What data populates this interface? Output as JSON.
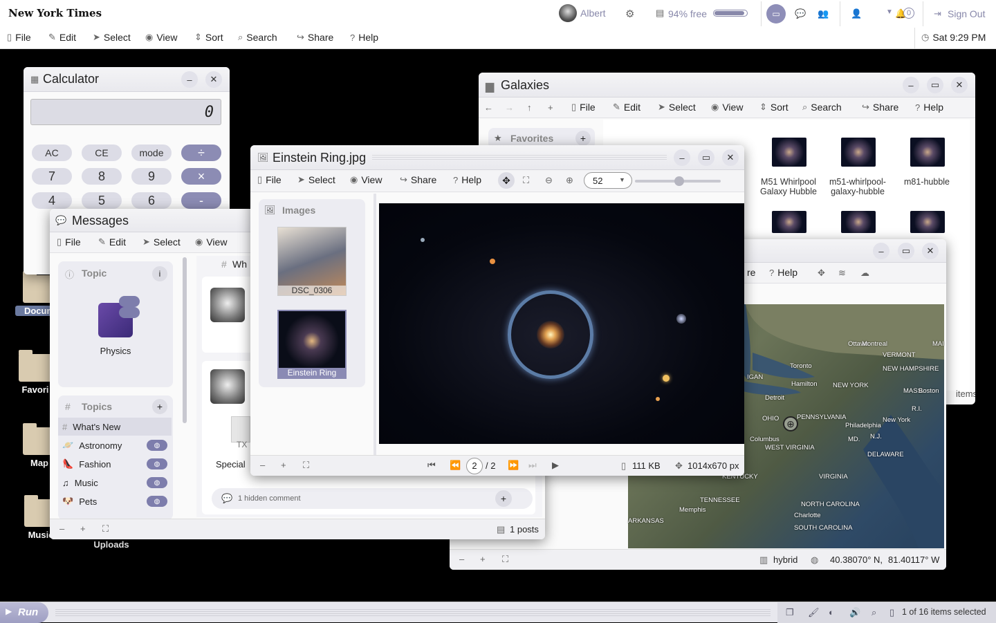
{
  "top": {
    "logo": "New York Times",
    "user": "Albert",
    "storage": "94% free",
    "storage_fraction": 0.94,
    "notif_count": "0",
    "signout": "Sign Out",
    "menu": [
      "File",
      "Edit",
      "Select",
      "View",
      "Sort",
      "Search",
      "Share",
      "Help"
    ],
    "clock": "Sat 9:29 PM"
  },
  "desktop": {
    "icons": [
      {
        "label": "Docum"
      },
      {
        "label": "Favori"
      },
      {
        "label": "Map"
      },
      {
        "label": "Music"
      },
      {
        "label": "Uploads"
      }
    ]
  },
  "calculator": {
    "title": "Calculator",
    "display": "0",
    "row1": [
      "AC",
      "CE",
      "mode",
      "÷"
    ],
    "row2": [
      "7",
      "8",
      "9",
      "×"
    ],
    "row3": [
      "4",
      "5",
      "6",
      "-"
    ]
  },
  "messages": {
    "title": "Messages",
    "menu": [
      "File",
      "Edit",
      "Select",
      "View"
    ],
    "topic_header": "Topic",
    "topic_name": "Physics",
    "topics_header": "Topics",
    "topics": [
      "What's New",
      "Astronomy",
      "Fashion",
      "Music",
      "Pets"
    ],
    "channel": "Wh",
    "post_label": "Special ",
    "file_label": "TX",
    "hidden_comment": "1 hidden comment",
    "posts": "1 posts"
  },
  "galaxies": {
    "title": "Galaxies",
    "menu": [
      "File",
      "Edit",
      "Select",
      "View",
      "Sort",
      "Search",
      "Share",
      "Help"
    ],
    "favorites": "Favorites",
    "items": [
      "M51 Whirlpool Galaxy Hubble",
      "m51-whirlpool-galaxy-hubble",
      "m81-hubble"
    ],
    "items_text": "items"
  },
  "map": {
    "menu": [
      "re",
      "Help"
    ],
    "type": "hybrid",
    "lat": "40.38070° N,",
    "lon": "81.40117° W",
    "places": [
      "Ottawa",
      "Montreal",
      "VERMONT",
      "NEW HAMPSHIRE",
      "Toronto",
      "Hamilton",
      "NEW YORK",
      "MASS.",
      "Boston",
      "Detroit",
      "PENNSYLVANIA",
      "Philadelphia",
      "New York",
      "R.I.",
      "OHIO",
      "Columbus",
      "MD.",
      "N.J.",
      "WEST VIRGINIA",
      "DELAWARE",
      "KENTUCKY",
      "VIRGINIA",
      "TENNESSEE",
      "NORTH CAROLINA",
      "Memphis",
      "Charlotte",
      "ARKANSAS",
      "SOUTH CAROLINA",
      "IGAN",
      "MAI"
    ]
  },
  "viewer": {
    "title": "Einstein Ring.jpg",
    "menu": [
      "File",
      "Select",
      "View",
      "Share",
      "Help"
    ],
    "zoom": "52",
    "zoom_fraction": 0.52,
    "sidebar_header": "Images",
    "thumbs": [
      "DSC_0306",
      "Einstein Ring"
    ],
    "page": "2",
    "page_total": "/ 2",
    "size": "111 KB",
    "dims": "1014x670 px"
  },
  "taskbar": {
    "run": "Run",
    "selection": "1 of 16 items selected"
  }
}
